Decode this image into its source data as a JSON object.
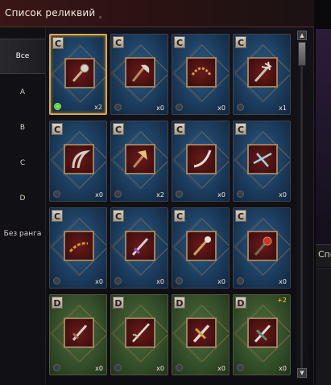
{
  "window": {
    "title": "Список реликвий"
  },
  "sidebar": {
    "tabs": [
      {
        "label": "Все",
        "active": true
      },
      {
        "label": "A",
        "active": false
      },
      {
        "label": "B",
        "active": false
      },
      {
        "label": "C",
        "active": false
      },
      {
        "label": "D",
        "active": false
      },
      {
        "label": "Без ранга",
        "active": false
      }
    ]
  },
  "relics": [
    {
      "rank": "C",
      "count": "x2",
      "gem": "active",
      "weapon": "mace-icon",
      "selected": true
    },
    {
      "rank": "C",
      "count": "x0",
      "gem": "inactive",
      "weapon": "axe-icon"
    },
    {
      "rank": "C",
      "count": "x0",
      "gem": "inactive",
      "weapon": "chain-whip-icon"
    },
    {
      "rank": "C",
      "count": "x1",
      "gem": "inactive",
      "weapon": "trident-icon"
    },
    {
      "rank": "C",
      "count": "x0",
      "gem": "inactive",
      "weapon": "scythe-icon"
    },
    {
      "rank": "C",
      "count": "x2",
      "gem": "inactive",
      "weapon": "double-axe-icon"
    },
    {
      "rank": "C",
      "count": "x0",
      "gem": "inactive",
      "weapon": "curved-sword-icon"
    },
    {
      "rank": "C",
      "count": "x0",
      "gem": "inactive",
      "weapon": "crossbow-icon"
    },
    {
      "rank": "C",
      "count": "x0",
      "gem": "inactive",
      "weapon": "flail-icon"
    },
    {
      "rank": "C",
      "count": "x0",
      "gem": "inactive",
      "weapon": "dagger-icon"
    },
    {
      "rank": "C",
      "count": "x0",
      "gem": "inactive",
      "weapon": "staff-icon"
    },
    {
      "rank": "C",
      "count": "x0",
      "gem": "inactive",
      "weapon": "spiked-mace-icon"
    },
    {
      "rank": "D",
      "count": "x0",
      "gem": "inactive",
      "weapon": "short-sword-icon"
    },
    {
      "rank": "D",
      "count": "x0",
      "gem": "inactive",
      "weapon": "rapier-icon"
    },
    {
      "rank": "D",
      "count": "x0",
      "gem": "inactive",
      "weapon": "broadsword-icon"
    },
    {
      "rank": "D",
      "count": "x0",
      "gem": "inactive",
      "weapon": "longsword-icon",
      "upgrade": "+2"
    }
  ],
  "side_panel": {
    "tab_label": "Спо"
  },
  "colors": {
    "c_rank_bg": "#1c3d5e",
    "d_rank_bg": "#35502a",
    "selected_border": "#d7a84a",
    "accent_red": "#3a1616"
  }
}
